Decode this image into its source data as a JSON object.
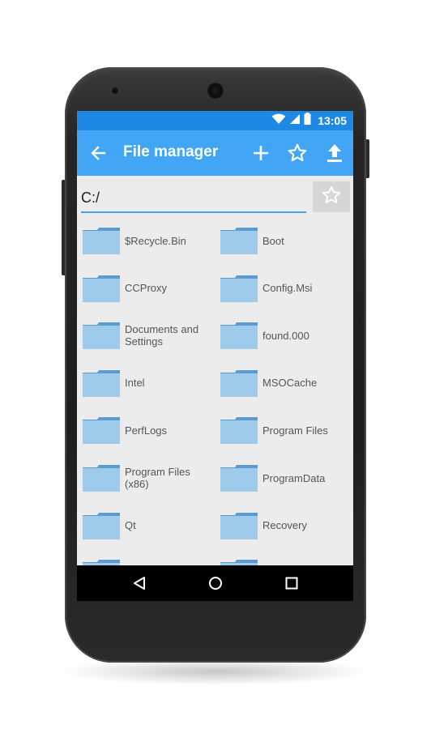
{
  "status_bar": {
    "time": "13:05",
    "icons": [
      "wifi-icon",
      "signal-icon",
      "battery-icon"
    ],
    "color": "#1e88e5"
  },
  "app_bar": {
    "title": "File manager",
    "color": "#42a5f5",
    "actions": [
      "back-arrow-icon",
      "plus-icon",
      "star-outline-icon",
      "upload-icon"
    ]
  },
  "path": {
    "value": "C:/"
  },
  "folders": [
    "$Recycle.Bin",
    "Boot",
    "CCProxy",
    "Config.Msi",
    "Documents and Settings",
    "found.000",
    "Intel",
    "MSOCache",
    "PerfLogs",
    "Program Files",
    "Program Files (x86)",
    "ProgramData",
    "Qt",
    "Recovery"
  ],
  "folder_color": "#9ecbec",
  "nav_bar": {
    "icons": [
      "back-triangle-icon",
      "home-circle-icon",
      "recents-square-icon"
    ]
  }
}
